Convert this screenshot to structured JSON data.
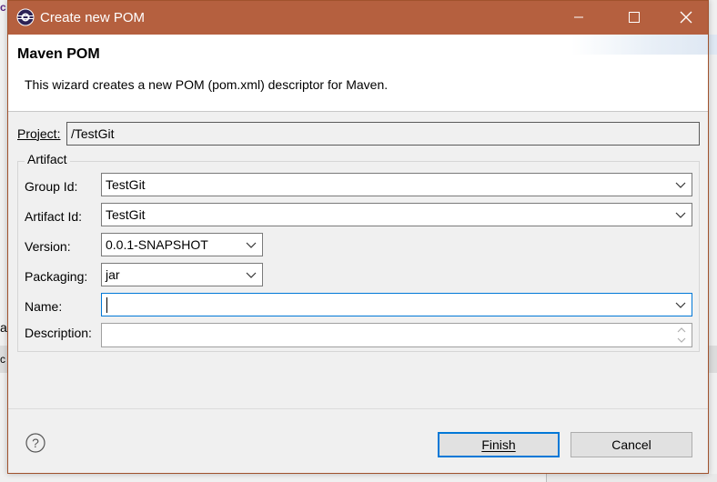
{
  "window": {
    "title": "Create new POM",
    "titlebar_color": "#b5603f"
  },
  "header": {
    "title": "Maven POM",
    "description": "This wizard creates a new POM (pom.xml) descriptor for Maven."
  },
  "project": {
    "label": "Project:",
    "value": "/TestGit"
  },
  "artifact_group": {
    "label": "Artifact",
    "group_id": {
      "label": "Group Id:",
      "value": "TestGit"
    },
    "artifact_id": {
      "label": "Artifact Id:",
      "value": "TestGit"
    },
    "version": {
      "label": "Version:",
      "value": "0.0.1-SNAPSHOT"
    },
    "packaging": {
      "label": "Packaging:",
      "value": "jar"
    },
    "name": {
      "label": "Name:",
      "value": ""
    },
    "description": {
      "label": "Description:",
      "value": ""
    }
  },
  "buttons": {
    "finish": "Finish",
    "cancel": "Cancel"
  },
  "icons": {
    "app": "eclipse-icon",
    "help": "help-icon"
  },
  "background": {
    "frag_top": "c",
    "frag_mid": "a",
    "frag_low": "c"
  },
  "colors": {
    "accent": "#0078d7"
  }
}
